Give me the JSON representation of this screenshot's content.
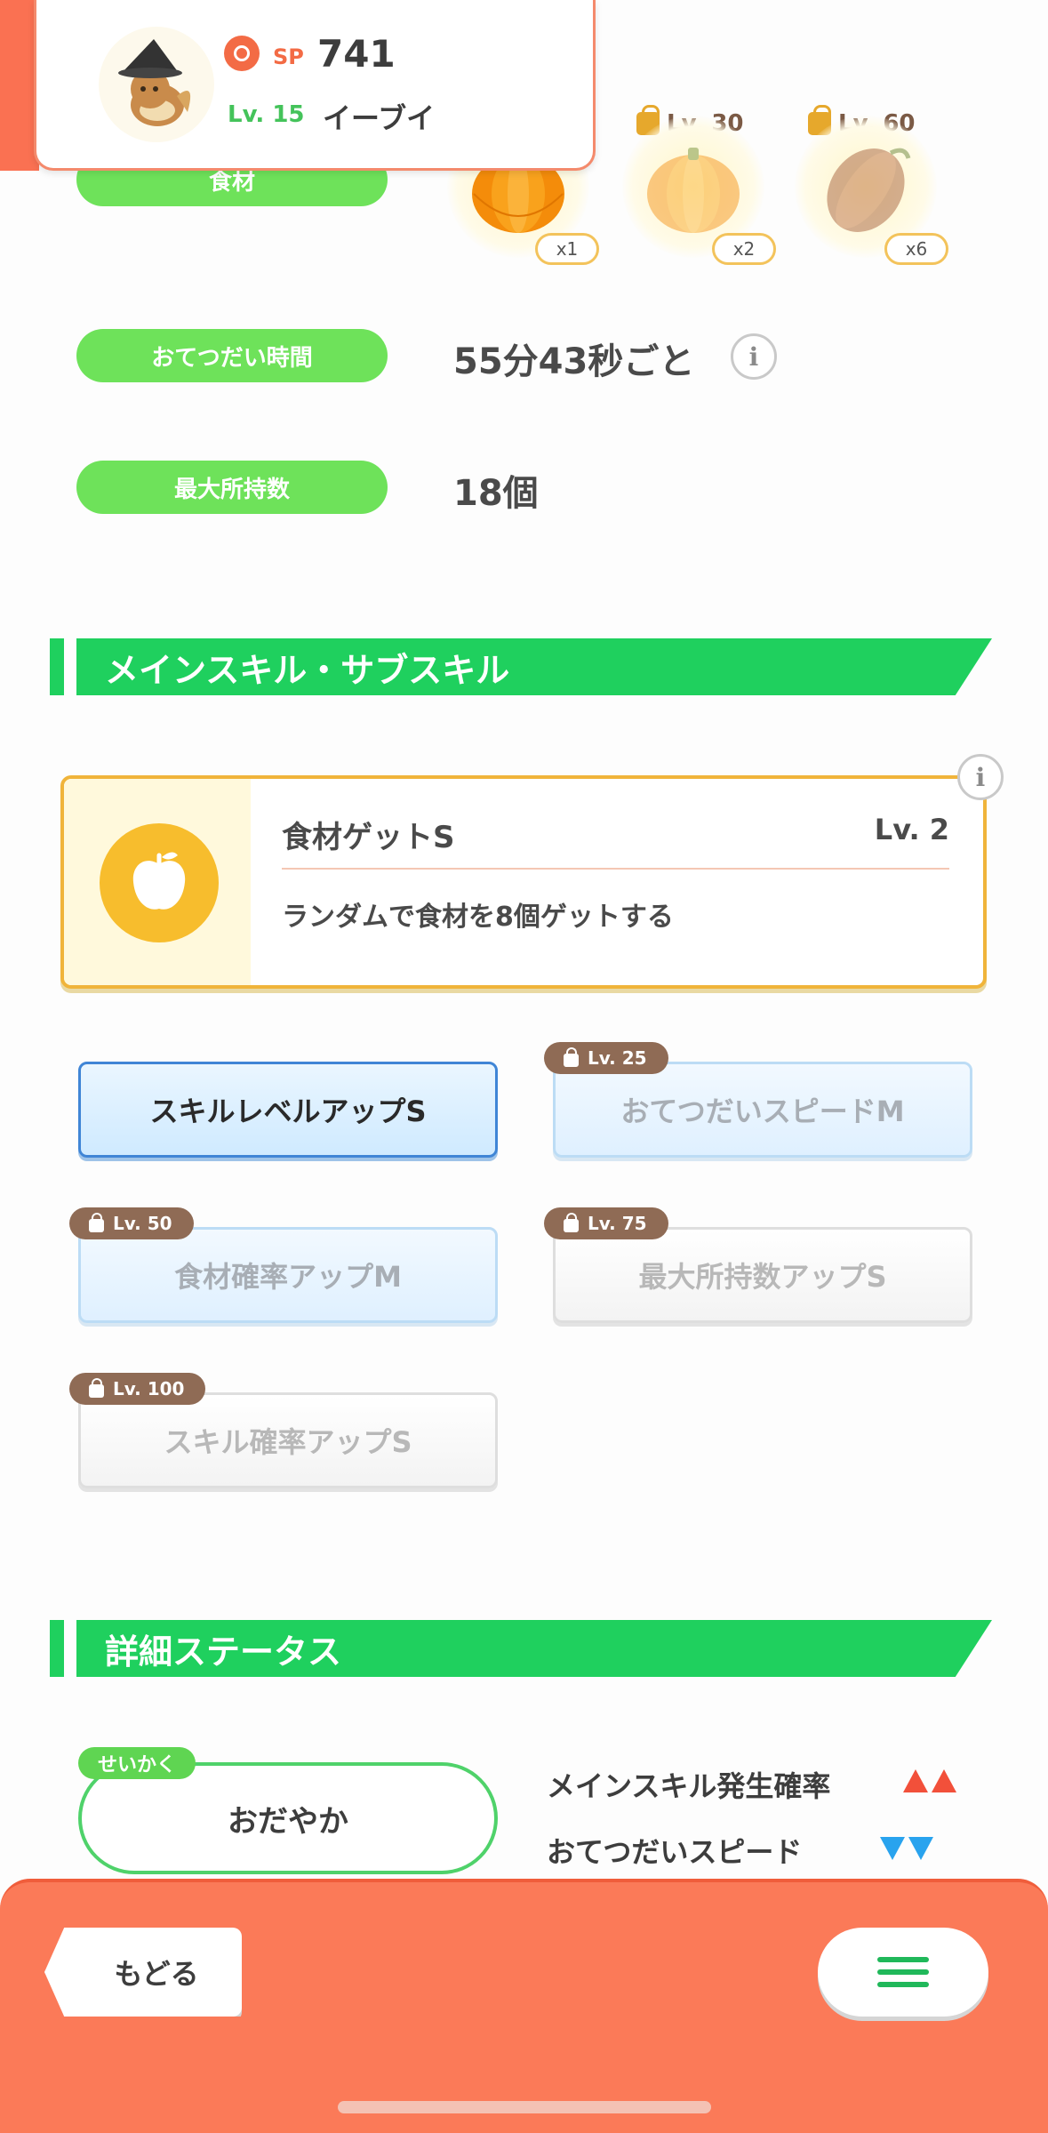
{
  "header": {
    "sp_label": "SP",
    "sp_value": "741",
    "level": "Lv. 15",
    "name": "イーブイ"
  },
  "ingredients": {
    "label": "食材",
    "items": [
      {
        "quantity": "x1",
        "unlock_level": "",
        "locked": false
      },
      {
        "quantity": "x2",
        "unlock_level": "Lv. 30",
        "locked": true
      },
      {
        "quantity": "x6",
        "unlock_level": "Lv. 60",
        "locked": true
      }
    ]
  },
  "help_time": {
    "label": "おてつだい時間",
    "value": "55分43秒ごと"
  },
  "max_carry": {
    "label": "最大所持数",
    "value": "18個"
  },
  "skills_section": {
    "title": "メインスキル・サブスキル",
    "main_skill": {
      "name": "食材ゲットS",
      "level": "Lv. 2",
      "description": "ランダムで食材を8個ゲットする"
    },
    "sub_skills": [
      {
        "label": "スキルレベルアップS",
        "unlock_level": "",
        "locked": false
      },
      {
        "label": "おてつだいスピードM",
        "unlock_level": "Lv. 25",
        "locked": true
      },
      {
        "label": "食材確率アップM",
        "unlock_level": "Lv. 50",
        "locked": true
      },
      {
        "label": "最大所持数アップS",
        "unlock_level": "Lv. 75",
        "locked": true
      },
      {
        "label": "スキル確率アップS",
        "unlock_level": "Lv. 100",
        "locked": true
      }
    ]
  },
  "details_section": {
    "title": "詳細ステータス",
    "nature_tag": "せいかく",
    "nature": "おだやか",
    "effects": [
      {
        "label": "メインスキル発生確率",
        "direction": "up",
        "count": 2,
        "color": "#f2503a"
      },
      {
        "label": "おてつだいスピード",
        "direction": "down",
        "count": 2,
        "color": "#29a3ee"
      }
    ]
  },
  "bottom_bar": {
    "back_label": "もどる",
    "menu_icon": "hamburger-menu-icon"
  },
  "colors": {
    "accent_green": "#1fd05e",
    "pill_green": "#6ee25a",
    "header_orange": "#fa7152",
    "skill_gold": "#f0b43a"
  }
}
